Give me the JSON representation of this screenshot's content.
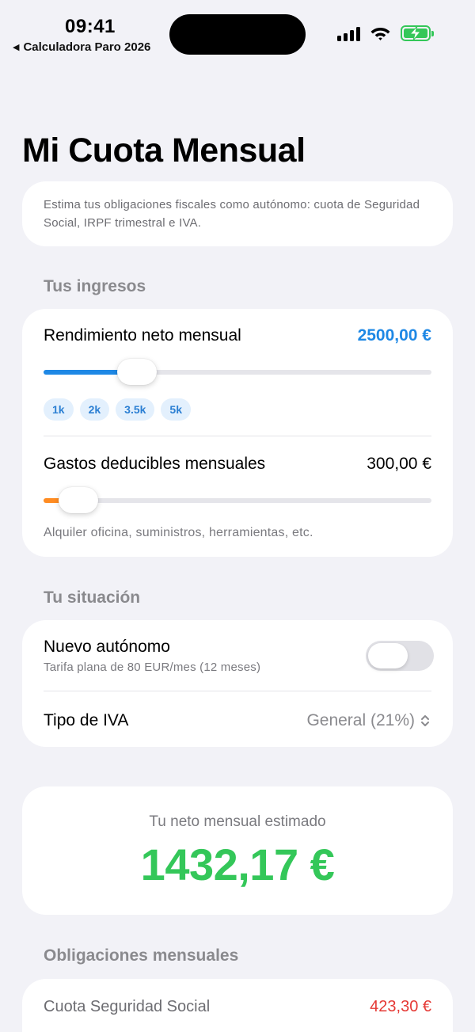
{
  "status_bar": {
    "time": "09:41",
    "back_app": "Calculadora Paro 2026",
    "battery_color": "#34c759"
  },
  "page": {
    "title": "Mi Cuota Mensual",
    "intro": "Estima tus obligaciones fiscales como autónomo: cuota de Seguridad Social, IRPF trimestral e IVA."
  },
  "ingresos": {
    "header": "Tus ingresos",
    "rendimiento": {
      "label": "Rendimiento neto mensual",
      "value": "2500,00 €",
      "slider_fraction": 0.24,
      "accent": "#1e88e5"
    },
    "presets": [
      "1k",
      "2k",
      "3.5k",
      "5k"
    ],
    "gastos": {
      "label": "Gastos deducibles mensuales",
      "value": "300,00 €",
      "slider_fraction": 0.09,
      "accent": "#ff8c22",
      "helper": "Alquiler oficina, suministros, herramientas, etc."
    }
  },
  "situacion": {
    "header": "Tu situación",
    "nuevo_autonomo": {
      "label": "Nuevo autónomo",
      "sub": "Tarifa plana de 80 EUR/mes (12 meses)",
      "on": false
    },
    "iva": {
      "label": "Tipo de IVA",
      "value": "General (21%)"
    }
  },
  "resultado": {
    "label": "Tu neto mensual estimado",
    "value": "1432,17 €",
    "color": "#34c759"
  },
  "obligaciones": {
    "header": "Obligaciones mensuales",
    "items": [
      {
        "label": "Cuota Seguridad Social",
        "value": "423,30 €",
        "color": "#e53935"
      }
    ]
  }
}
